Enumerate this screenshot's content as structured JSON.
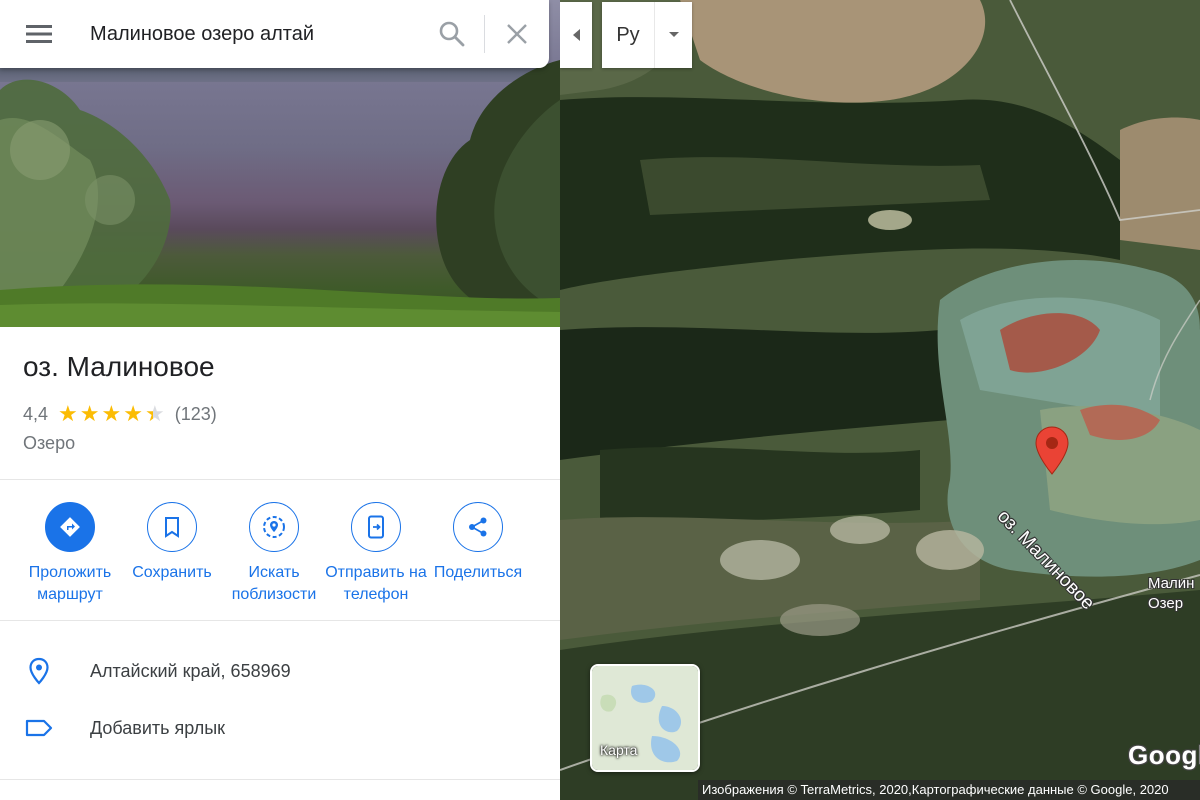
{
  "search": {
    "value": "Малиновое озеро алтай",
    "icons": [
      "menu-icon",
      "search-icon",
      "close-icon"
    ]
  },
  "place": {
    "title": "оз. Малиновое",
    "rating": "4,4",
    "rating_value": 4.4,
    "review_count": "(123)",
    "type": "Озеро"
  },
  "actions": [
    {
      "label": "Проложить маршрут",
      "icon": "directions-icon",
      "primary": true
    },
    {
      "label": "Сохранить",
      "icon": "bookmark-icon"
    },
    {
      "label": "Искать поблизости",
      "icon": "nearby-icon"
    },
    {
      "label": "Отправить на телефон",
      "icon": "send-to-phone-icon"
    },
    {
      "label": "Поделиться",
      "icon": "share-icon"
    }
  ],
  "details": {
    "address": "Алтайский край, 658969",
    "add_label": "Добавить ярлык"
  },
  "map": {
    "language_button": "Ру",
    "pin_label": "оз. Малиновое",
    "partial_label_line1": "Малин",
    "partial_label_line2": "Озер",
    "minimap_label": "Карта",
    "logo": "Googl",
    "attribution": "Изображения © TerraMetrics, 2020,Картографические данные © Google, 2020"
  },
  "colors": {
    "accent": "#1a73e8",
    "star": "#fbbc04",
    "pin": "#ea4335"
  }
}
